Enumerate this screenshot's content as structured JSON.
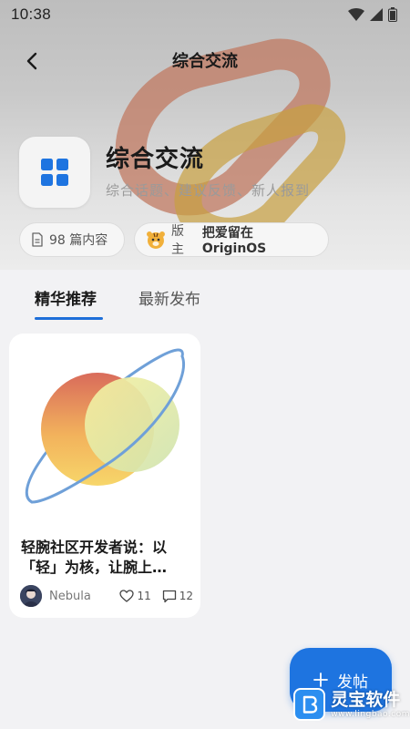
{
  "status_bar": {
    "time": "10:38"
  },
  "nav": {
    "title": "综合交流"
  },
  "forum": {
    "name": "综合交流",
    "description": "综合话题、建议反馈、新人报到",
    "content_count": "98 篇内容",
    "moderator_label": "版主",
    "moderator_name": "把爱留在OriginOS"
  },
  "tabs": [
    {
      "label": "精华推荐",
      "active": true
    },
    {
      "label": "最新发布",
      "active": false
    }
  ],
  "posts": [
    {
      "title": "轻腕社区开发者说：以\n「轻」为核，让腕上…",
      "author": "Nebula",
      "likes": "11",
      "comments": "12"
    }
  ],
  "fab": {
    "label": "发帖"
  },
  "watermark": {
    "text": "灵宝软件",
    "url": "www.lingbao.com"
  },
  "colors": {
    "accent": "#1e74e0",
    "tab_underline": "#1e6fd9"
  },
  "icons": {
    "back": "chevron-left-icon",
    "forum": "grid-icon",
    "document": "document-icon",
    "moderator_avatar": "tiger-avatar-icon",
    "like": "heart-icon",
    "comment": "comment-icon",
    "plus": "plus-icon"
  }
}
